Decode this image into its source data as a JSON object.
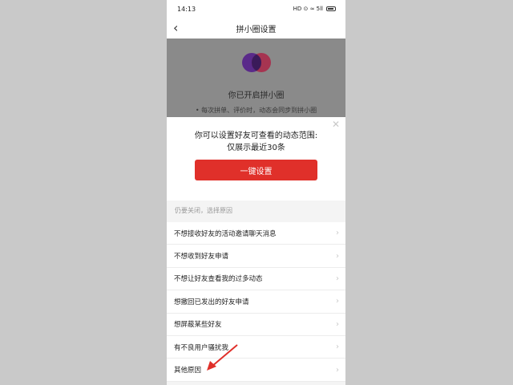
{
  "status_bar": {
    "time": "14:13",
    "icons": "HD  ⊙  ≈ 5ll"
  },
  "nav": {
    "title": "拼小圈设置",
    "back_icon": "chevron-left-icon"
  },
  "background": {
    "title": "你已开启拼小圈",
    "subtitle": "• 每次拼单、评价时，动态会同步到拼小圈"
  },
  "popup": {
    "line1": "你可以设置好友可查看的动态范围:",
    "line2": "仅展示最近30条",
    "button_label": "一键设置",
    "close_icon": "close-icon"
  },
  "reasons": {
    "label": "仍要关闭，选择原因",
    "items": [
      "不想接收好友的活动邀请聊天消息",
      "不想收到好友申请",
      "不想让好友查看我的过多动态",
      "想撤回已发出的好友申请",
      "想屏蔽某些好友",
      "有不良用户骚扰我",
      "其他原因"
    ]
  },
  "colors": {
    "accent": "#e0302a",
    "annotation_arrow": "#e0302a"
  }
}
